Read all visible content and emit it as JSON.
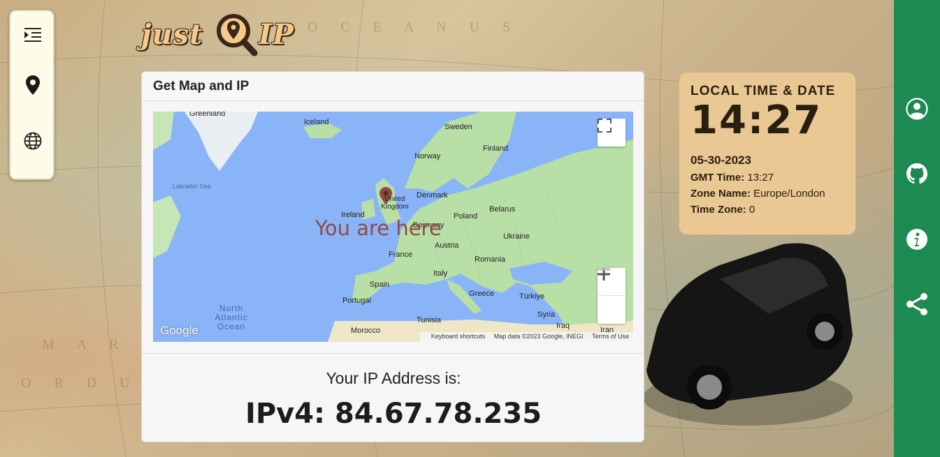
{
  "logo": {
    "text_left": "just",
    "text_right": "IP"
  },
  "left_sidebar": {
    "icons": [
      "menu-indent-icon",
      "map-pin-icon",
      "globe-icon"
    ]
  },
  "card": {
    "header": "Get Map and IP",
    "map": {
      "overlay_text": "You are here",
      "labels": {
        "greenland": "Greenland",
        "iceland": "Iceland",
        "sweden": "Sweden",
        "finland": "Finland",
        "norway": "Norway",
        "labrador_sea": "Labrador Sea",
        "united_kingdom": "United Kingdom",
        "denmark": "Denmark",
        "ireland": "Ireland",
        "poland": "Poland",
        "belarus": "Belarus",
        "germany": "Germany",
        "ukraine": "Ukraine",
        "austria": "Austria",
        "france": "France",
        "romania": "Romania",
        "italy": "Italy",
        "spain": "Spain",
        "portugal": "Portugal",
        "greece": "Greece",
        "turkiye": "Türkiye",
        "north_atlantic_ocean": "North Atlantic Ocean",
        "tunisia": "Tunisia",
        "syria": "Syria",
        "iraq": "Iraq",
        "morocco": "Morocco",
        "iran": "Iran"
      },
      "google_logo": "Google",
      "footer": {
        "shortcuts": "Keyboard shortcuts",
        "map_data": "Map data ©2023 Google, INEGI",
        "terms": "Terms of Use"
      }
    },
    "ip_title": "Your IP Address is:",
    "ip_value": "IPv4: 84.67.78.235"
  },
  "time_card": {
    "heading": "LOCAL TIME & DATE",
    "time": "14:27",
    "date": "05-30-2023",
    "gmt_label": "GMT Time:",
    "gmt_value": "13:27",
    "zone_label": "Zone Name:",
    "zone_value": "Europe/London",
    "tz_label": "Time Zone:",
    "tz_value": "0"
  },
  "right_sidebar": {
    "icons": [
      "user-icon",
      "github-icon",
      "info-icon",
      "share-icon"
    ]
  },
  "colors": {
    "right_sidebar": "#1d8a52",
    "time_card": "#e9c893",
    "pin": "#8f4a43",
    "water": "#8ab4f8",
    "land": "#b8dfa6"
  }
}
